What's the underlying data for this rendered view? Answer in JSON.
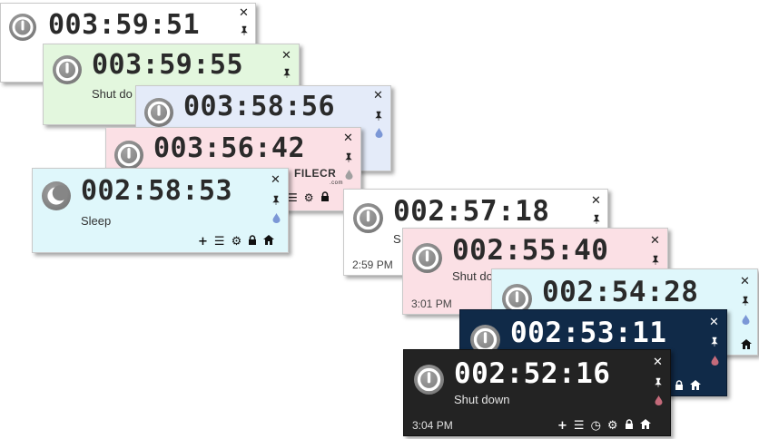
{
  "colors": {
    "win1": "#ffffff",
    "win2": "#e3f7de",
    "win3": "#e4ebf9",
    "win4": "#fbe0e5",
    "win5": "#dff7fb",
    "win6": "#ffffff",
    "win7": "#fbe0e5",
    "win8": "#dff7fb",
    "win9": "#102a48",
    "win10": "#232323",
    "drop_blue": "#7b97d6",
    "drop_red": "#c46a7a"
  },
  "icons": {
    "close": "✕",
    "pin": "📌",
    "add": "+",
    "menu": "☰",
    "timer": "◷",
    "settings": "⚙",
    "lock": "🔒",
    "home": "⌂"
  },
  "watermark": {
    "brand": "FILECR",
    "tld": ".com"
  },
  "windows": [
    {
      "time": "003:59:51",
      "action": "",
      "clock": ""
    },
    {
      "time": "003:59:55",
      "action": "Shut do",
      "clock": ""
    },
    {
      "time": "003:58:56",
      "action": "",
      "clock": ""
    },
    {
      "time": "003:56:42",
      "action": "",
      "clock": ""
    },
    {
      "time": "002:58:53",
      "action": "Sleep",
      "clock": ""
    },
    {
      "time": "002:57:18",
      "action": "S",
      "clock": "2:59 PM"
    },
    {
      "time": "002:55:40",
      "action": "Shut do",
      "clock": "3:01 PM"
    },
    {
      "time": "002:54:28",
      "action": "",
      "clock": ""
    },
    {
      "time": "002:53:11",
      "action": "",
      "clock": ""
    },
    {
      "time": "002:52:16",
      "action": "Shut down",
      "clock": "3:04 PM"
    }
  ]
}
